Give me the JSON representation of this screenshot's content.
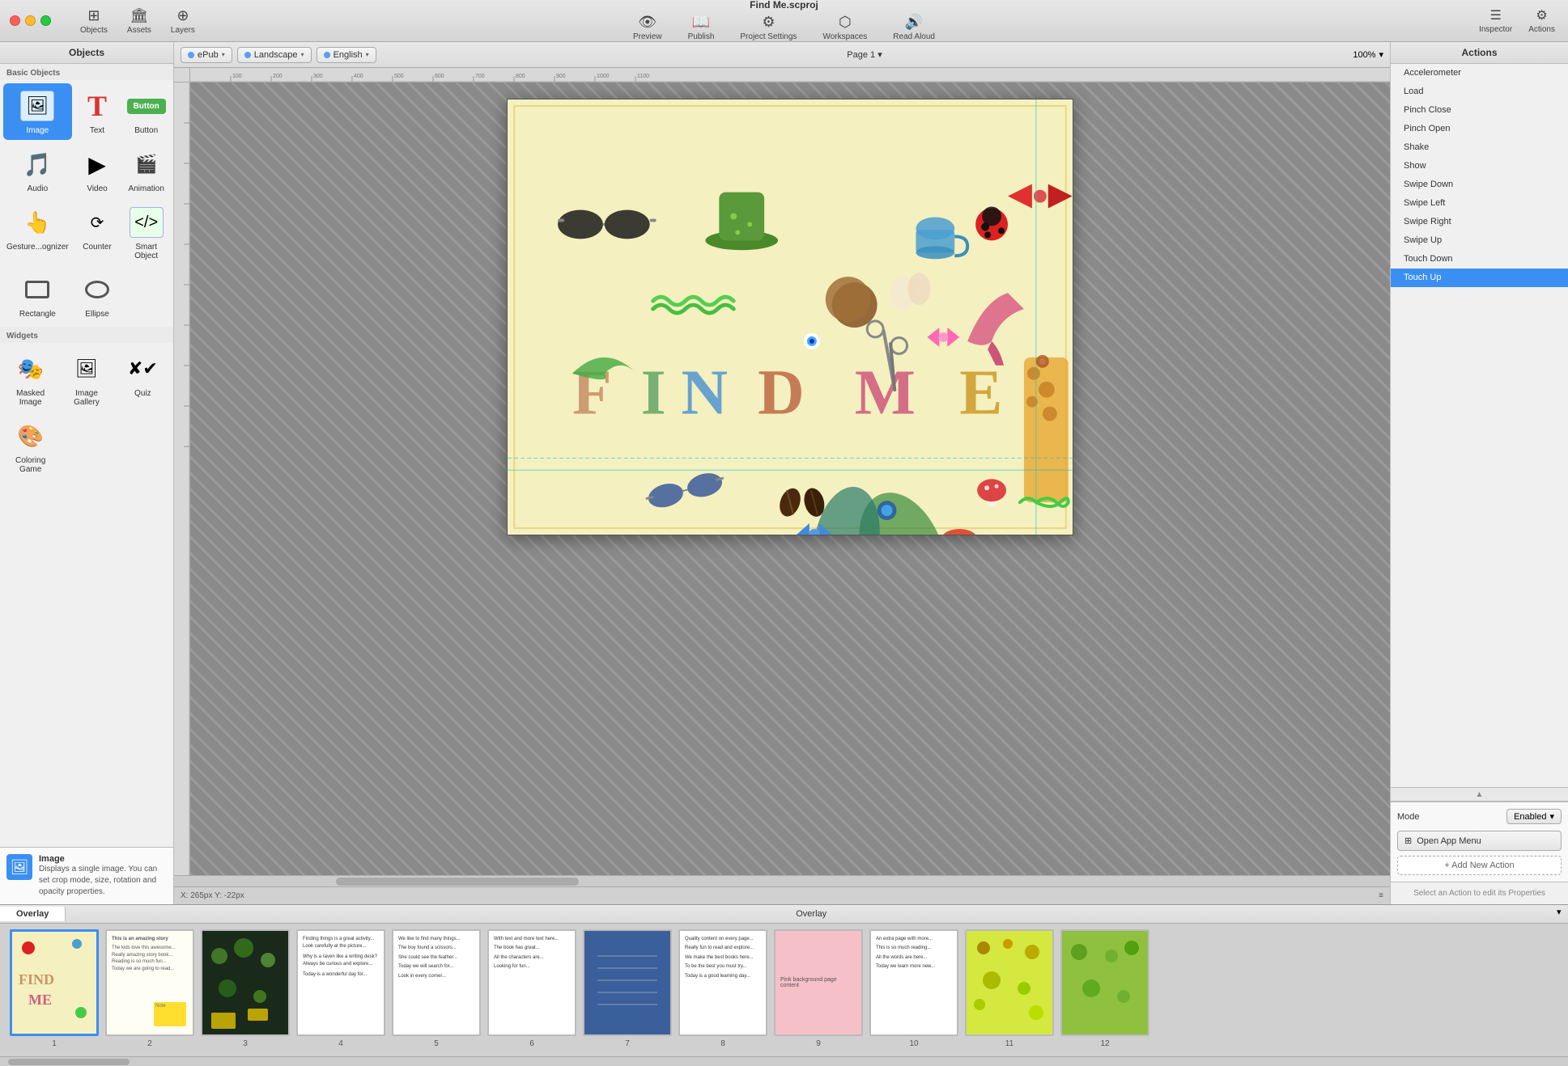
{
  "app": {
    "title": "Find Me.scproj",
    "traffic_lights": [
      "close",
      "minimize",
      "maximize"
    ]
  },
  "toolbar": {
    "preview_label": "Preview",
    "publish_label": "Publish",
    "project_settings_label": "Project Settings",
    "workspaces_label": "Workspaces",
    "read_aloud_label": "Read Aloud",
    "inspector_label": "Inspector",
    "actions_label": "Actions"
  },
  "objects_panel": {
    "title": "Objects",
    "sections": {
      "basic": "Basic Objects",
      "widgets": "Widgets"
    },
    "basic_objects": [
      {
        "id": "image",
        "label": "Image",
        "selected": true
      },
      {
        "id": "text",
        "label": "Text"
      },
      {
        "id": "button",
        "label": "Button"
      },
      {
        "id": "audio",
        "label": "Audio"
      },
      {
        "id": "video",
        "label": "Video"
      },
      {
        "id": "animation",
        "label": "Animation"
      },
      {
        "id": "gesture",
        "label": "Gesture...ognizer"
      },
      {
        "id": "counter",
        "label": "Counter"
      },
      {
        "id": "smart",
        "label": "Smart Object"
      },
      {
        "id": "rectangle",
        "label": "Rectangle"
      },
      {
        "id": "ellipse",
        "label": "Ellipse"
      }
    ],
    "widgets": [
      {
        "id": "masked-image",
        "label": "Masked Image"
      },
      {
        "id": "image-gallery",
        "label": "Image Gallery"
      },
      {
        "id": "quiz",
        "label": "Quiz"
      },
      {
        "id": "coloring-game",
        "label": "Coloring Game"
      }
    ],
    "tooltip": {
      "title": "Image",
      "description": "Displays a single image. You can set crop mode, size, rotation and opacity properties."
    }
  },
  "canvas_toolbar": {
    "epub_label": "ePub",
    "landscape_label": "Landscape",
    "english_label": "English",
    "page_label": "Page 1",
    "zoom_label": "100%"
  },
  "actions_panel": {
    "title": "Actions",
    "items": [
      {
        "id": "accelerometer",
        "label": "Accelerometer"
      },
      {
        "id": "load",
        "label": "Load"
      },
      {
        "id": "pinch-close",
        "label": "Pinch Close"
      },
      {
        "id": "pinch-open",
        "label": "Pinch Open"
      },
      {
        "id": "shake",
        "label": "Shake"
      },
      {
        "id": "show",
        "label": "Show"
      },
      {
        "id": "swipe-down",
        "label": "Swipe Down"
      },
      {
        "id": "swipe-left",
        "label": "Swipe Left"
      },
      {
        "id": "swipe-right",
        "label": "Swipe Right"
      },
      {
        "id": "swipe-up",
        "label": "Swipe Up"
      },
      {
        "id": "touch-down",
        "label": "Touch Down"
      },
      {
        "id": "touch-up",
        "label": "Touch Up",
        "selected": true
      }
    ],
    "mode_label": "Mode",
    "mode_value": "Enabled",
    "open_app_menu_label": "Open App Menu",
    "add_action_label": "+ Add New Action",
    "footer_text": "Select an Action to edit its Properties"
  },
  "filmstrip": {
    "tab_overlay": "Overlay",
    "overlay_label": "Overlay",
    "pages": [
      {
        "num": "1",
        "active": true,
        "bg": "findme"
      },
      {
        "num": "2",
        "active": false,
        "bg": "text"
      },
      {
        "num": "3",
        "active": false,
        "bg": "dark"
      },
      {
        "num": "4",
        "active": false,
        "bg": "text2"
      },
      {
        "num": "5",
        "active": false,
        "bg": "white"
      },
      {
        "num": "6",
        "active": false,
        "bg": "white2"
      },
      {
        "num": "7",
        "active": false,
        "bg": "blue"
      },
      {
        "num": "8",
        "active": false,
        "bg": "white3"
      },
      {
        "num": "9",
        "active": false,
        "bg": "pink"
      },
      {
        "num": "10",
        "active": false,
        "bg": "white4"
      },
      {
        "num": "11",
        "active": false,
        "bg": "yellow"
      },
      {
        "num": "12",
        "active": false,
        "bg": "green"
      }
    ]
  },
  "status": {
    "coords": "X: 265px   Y: -22px"
  }
}
